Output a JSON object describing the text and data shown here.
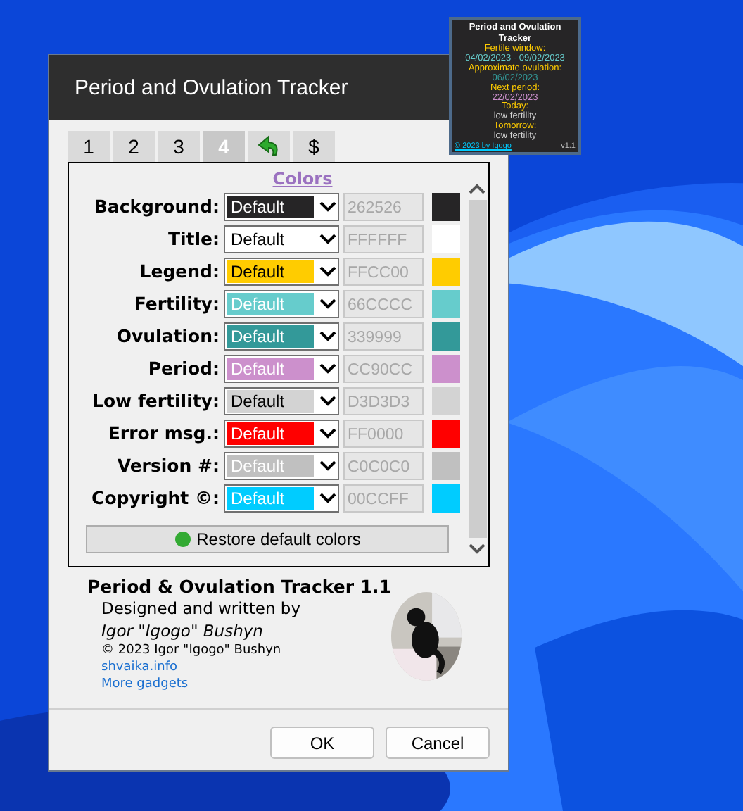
{
  "gadget": {
    "title": "Period and Ovulation Tracker",
    "lines": [
      {
        "text": "Fertile window:",
        "color": "#ffcc00"
      },
      {
        "text": "04/02/2023 - 09/02/2023",
        "color": "#66cccc"
      },
      {
        "text": "Approximate ovulation:",
        "color": "#ffcc00"
      },
      {
        "text": "06/02/2023",
        "color": "#339999"
      },
      {
        "text": "Next period:",
        "color": "#ffcc00"
      },
      {
        "text": "22/02/2023",
        "color": "#cc90cc"
      },
      {
        "text": "Today:",
        "color": "#ffcc00"
      },
      {
        "text": "low fertility",
        "color": "#d3d3d3"
      },
      {
        "text": "Tomorrow:",
        "color": "#ffcc00"
      },
      {
        "text": "low fertility",
        "color": "#d3d3d3"
      }
    ],
    "copyright": "© 2023 by Igogo",
    "version": "v1.1"
  },
  "window": {
    "title": "Period and Ovulation Tracker"
  },
  "tabs": [
    {
      "kind": "text",
      "label": "1",
      "selected": false
    },
    {
      "kind": "text",
      "label": "2",
      "selected": false
    },
    {
      "kind": "text",
      "label": "3",
      "selected": false
    },
    {
      "kind": "text",
      "label": "4",
      "selected": true
    },
    {
      "kind": "icon",
      "selected": false
    },
    {
      "kind": "text",
      "label": "$",
      "selected": false
    }
  ],
  "section_title": "Colors",
  "colors": [
    {
      "label": "Background:",
      "value": "Default",
      "hex": "262526",
      "color": "#262526"
    },
    {
      "label": "Title:",
      "value": "Default",
      "hex": "FFFFFF",
      "color": "#ffffff"
    },
    {
      "label": "Legend:",
      "value": "Default",
      "hex": "FFCC00",
      "color": "#ffcc00"
    },
    {
      "label": "Fertility:",
      "value": "Default",
      "hex": "66CCCC",
      "color": "#66cccc"
    },
    {
      "label": "Ovulation:",
      "value": "Default",
      "hex": "339999",
      "color": "#339999"
    },
    {
      "label": "Period:",
      "value": "Default",
      "hex": "CC90CC",
      "color": "#cc90cc"
    },
    {
      "label": "Low fertility:",
      "value": "Default",
      "hex": "D3D3D3",
      "color": "#d3d3d3"
    },
    {
      "label": "Error msg.:",
      "value": "Default",
      "hex": "FF0000",
      "color": "#ff0000"
    },
    {
      "label": "Version #:",
      "value": "Default",
      "hex": "C0C0C0",
      "color": "#c0c0c0"
    },
    {
      "label": "Copyright ©:",
      "value": "Default",
      "hex": "00CCFF",
      "color": "#00ccff"
    }
  ],
  "restore_button": "Restore default colors",
  "about": {
    "name": "Period & Ovulation Tracker 1.1",
    "designed": "Designed and written by",
    "author": "Igor \"Igogo\" Bushyn",
    "copyright": "© 2023 Igor \"Igogo\" Bushyn",
    "links": [
      "shvaika.info",
      "More gadgets"
    ]
  },
  "buttons": [
    "OK",
    "Cancel"
  ]
}
